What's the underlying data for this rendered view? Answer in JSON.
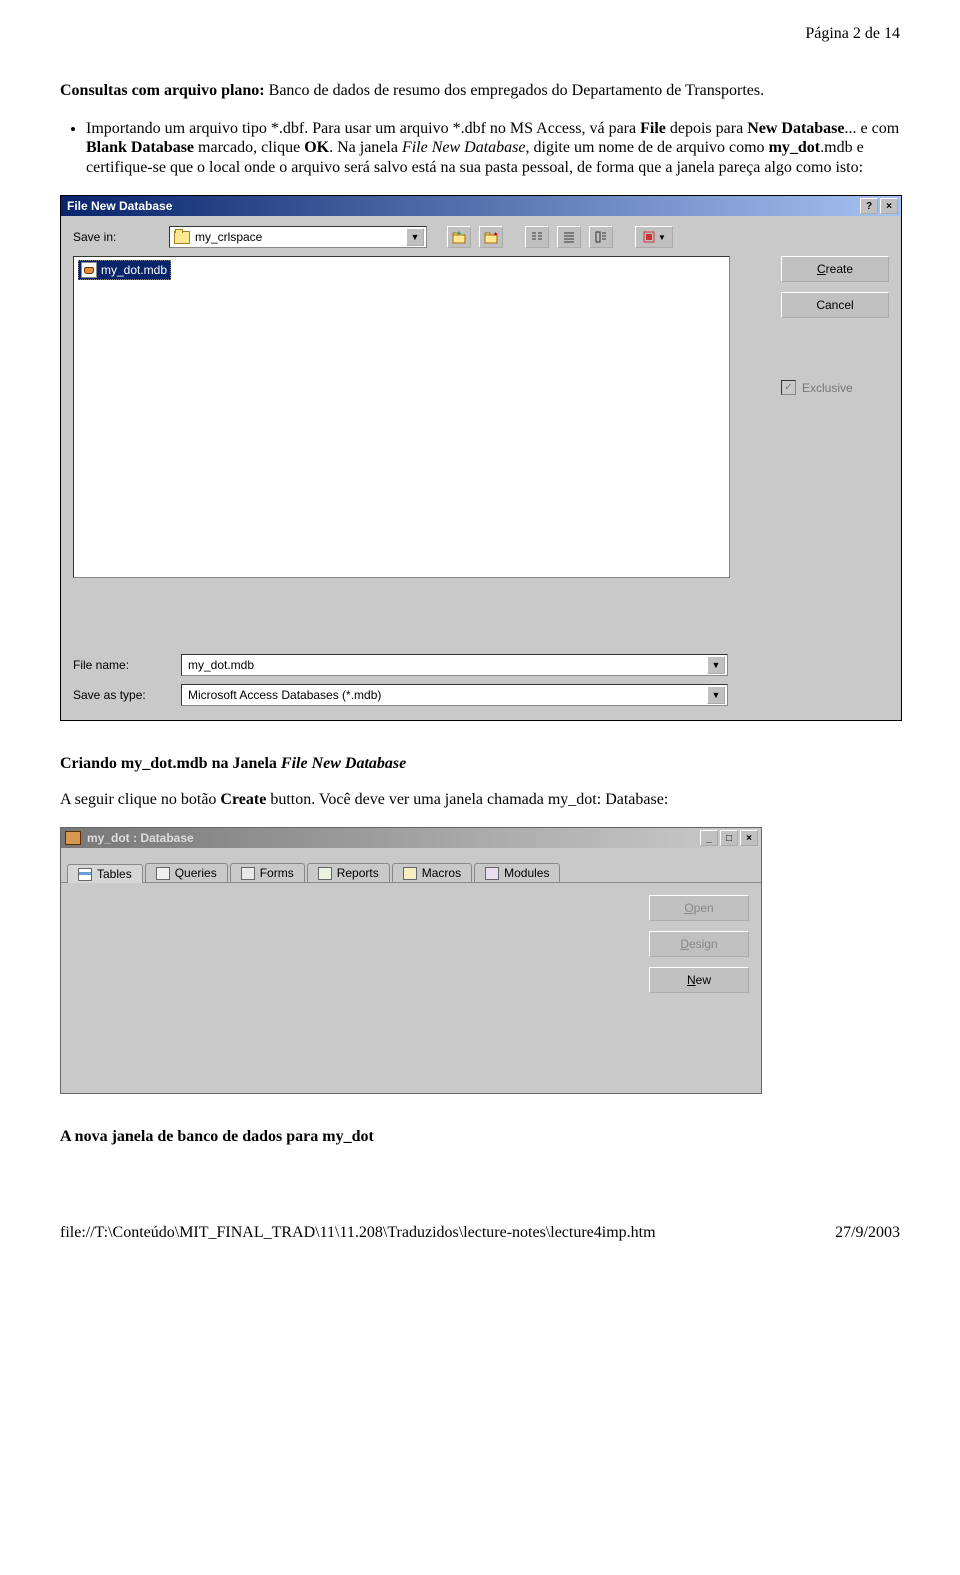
{
  "page_header": "Página 2 de 14",
  "intro": {
    "bold1": "Consultas com arquivo plano:",
    "rest1": " Banco de dados de resumo dos empregados do Departamento de Transportes."
  },
  "bullet": {
    "pre": "Importando um arquivo tipo *.dbf. Para usar um arquivo *.dbf no MS Access, vá para ",
    "b_file": "File",
    "mid1": " depois para ",
    "b_newdb": "New Database",
    "mid2": "... e com ",
    "b_blank": "Blank Database",
    "mid3": " marcado, clique ",
    "b_ok": "OK",
    "mid4": ". Na janela ",
    "i_filenew": "File New Database",
    "mid5": ", digite um nome de de arquivo como ",
    "b_mydot": "my_dot",
    "post": ".mdb e certifique-se que o local onde o arquivo será salvo está na sua pasta pessoal, de forma que a janela pareça algo como isto:"
  },
  "dialog1": {
    "title": "File New Database",
    "help_btn": "?",
    "close_btn": "×",
    "save_in_label": "Save in:",
    "save_in_value": "my_crlspace",
    "file_item": "my_dot.mdb",
    "create_label_pre": "",
    "create_label_u": "C",
    "create_label_post": "reate",
    "cancel_label": "Cancel",
    "exclusive_label": "Exclusive",
    "file_name_label": "File name:",
    "file_name_value": "my_dot.mdb",
    "save_as_type_label": "Save as type:",
    "save_as_type_value": "Microsoft Access Databases (*.mdb)"
  },
  "caption1": {
    "bold": "Criando my_dot.mdb na Janela ",
    "italic": "File New Database"
  },
  "para2": {
    "pre": "A seguir clique no botão ",
    "b_create": "Create",
    "mid": " button. Você deve ver uma janela chamada my_dot: Database:"
  },
  "window2": {
    "title": "my_dot : Database",
    "min": "_",
    "max": "□",
    "close": "×",
    "tabs": [
      "Tables",
      "Queries",
      "Forms",
      "Reports",
      "Macros",
      "Modules"
    ],
    "open_u": "O",
    "open_rest": "pen",
    "design_u": "D",
    "design_rest": "esign",
    "new_u": "N",
    "new_rest": "ew"
  },
  "caption2": "A nova janela de banco de dados para my_dot",
  "footer": {
    "path": "file://T:\\Conteúdo\\MIT_FINAL_TRAD\\11\\11.208\\Traduzidos\\lecture-notes\\lecture4imp.htm",
    "date": "27/9/2003"
  }
}
